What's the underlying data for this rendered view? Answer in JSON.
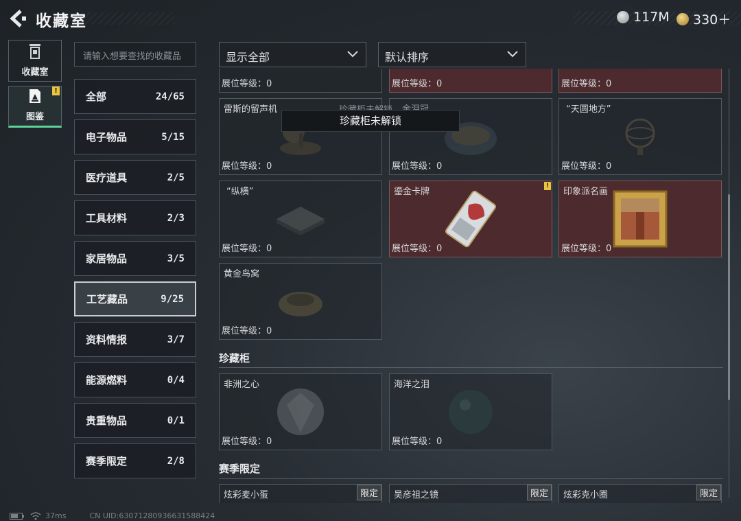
{
  "header": {
    "title": "收藏室",
    "currency_silver": "117M",
    "currency_gold": "330＋"
  },
  "nav": [
    {
      "label": "收藏室",
      "icon": "trash-bin-icon"
    },
    {
      "label": "图鉴",
      "icon": "catalog-book-icon",
      "badge": "!"
    }
  ],
  "search": {
    "placeholder": "请输入想要查找的收藏品"
  },
  "categories": [
    {
      "label": "全部",
      "count": "24/65"
    },
    {
      "label": "电子物品",
      "count": "5/15"
    },
    {
      "label": "医疗道具",
      "count": "2/5"
    },
    {
      "label": "工具材料",
      "count": "2/3"
    },
    {
      "label": "家居物品",
      "count": "3/5"
    },
    {
      "label": "工艺藏品",
      "count": "9/25"
    },
    {
      "label": "资料情报",
      "count": "3/7"
    },
    {
      "label": "能源燃料",
      "count": "0/4"
    },
    {
      "label": "贵重物品",
      "count": "0/1"
    },
    {
      "label": "赛季限定",
      "count": "2/8"
    }
  ],
  "filters": {
    "display": "显示全部",
    "sort": "默认排序"
  },
  "level_label": "展位等级：0",
  "items_row0": [
    "展位等级：0",
    "展位等级：0",
    "展位等级：0"
  ],
  "items": [
    {
      "name": "雷斯的留声机"
    },
    {
      "name": "金泪冠"
    },
    {
      "name": "“天圆地方”"
    },
    {
      "name": "“纵横”"
    },
    {
      "name": "鎏金卡牌",
      "badge": "!"
    },
    {
      "name": "印象派名画"
    },
    {
      "name": "黄金鸟窝"
    }
  ],
  "toast": {
    "text": "珍藏柜未解锁",
    "ghost": "珍藏柜未解锁"
  },
  "sections": {
    "cabinet": {
      "title": "珍藏柜",
      "items": [
        {
          "name": "非洲之心"
        },
        {
          "name": "海洋之泪"
        }
      ]
    },
    "season": {
      "title": "赛季限定",
      "tag": "限定",
      "items": [
        {
          "name": "炫彩麦小蛋"
        },
        {
          "name": "吴彦祖之镜"
        },
        {
          "name": "炫彩克小圈"
        }
      ]
    }
  },
  "footer": {
    "ping": "37ms",
    "uid": "CN UID:63071280936631588424"
  },
  "colors": {
    "accent_green": "#5ed39a",
    "warning_yellow": "#e9c441",
    "owned_red": "#4d2a2e"
  }
}
